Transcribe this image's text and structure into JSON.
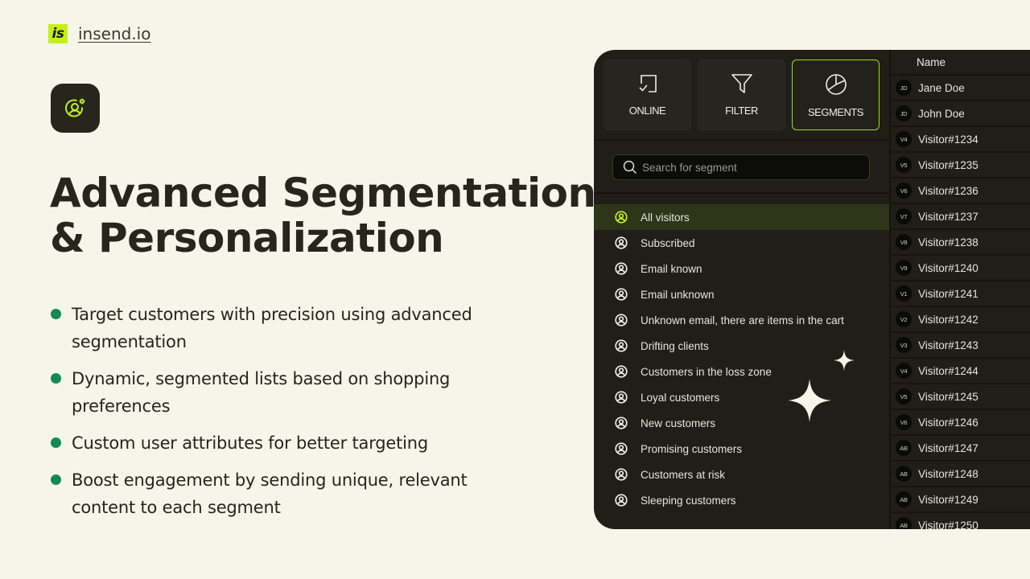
{
  "brand": {
    "logo_text": "is",
    "name": "insend.io",
    "accent": "#c4f01a"
  },
  "feature_icon": "user-settings-icon",
  "headline": {
    "line1": "Advanced Segmentation",
    "line2": "& Personalization"
  },
  "bullets": [
    "Target customers with precision using advanced segmentation",
    "Dynamic, segmented lists based on shopping preferences",
    "Custom user attributes for better targeting",
    "Boost engagement by sending unique, relevant content to each segment"
  ],
  "bullet_color": "#138a55",
  "panel": {
    "tabs": [
      {
        "label": "ONLINE",
        "icon": "chat-check-icon",
        "active": false
      },
      {
        "label": "FILTER",
        "icon": "funnel-icon",
        "active": false
      },
      {
        "label": "SEGMENTS",
        "icon": "pie-chart-icon",
        "active": true
      }
    ],
    "search": {
      "placeholder": "Search for segment",
      "value": ""
    },
    "segments": [
      {
        "label": "All visitors",
        "active": true
      },
      {
        "label": "Subscribed"
      },
      {
        "label": "Email known"
      },
      {
        "label": "Email unknown"
      },
      {
        "label": "Unknown email, there are items in the cart"
      },
      {
        "label": "Drifting clients"
      },
      {
        "label": "Customers in the loss zone"
      },
      {
        "label": "Loyal customers"
      },
      {
        "label": "New customers"
      },
      {
        "label": "Promising customers"
      },
      {
        "label": "Customers at risk"
      },
      {
        "label": "Sleeping customers"
      }
    ],
    "people_header": "Name",
    "people": [
      {
        "initials": "JD",
        "name": "Jane Doe"
      },
      {
        "initials": "JD",
        "name": "John Doe"
      },
      {
        "initials": "V4",
        "name": "Visitor#1234"
      },
      {
        "initials": "V5",
        "name": "Visitor#1235"
      },
      {
        "initials": "V6",
        "name": "Visitor#1236"
      },
      {
        "initials": "V7",
        "name": "Visitor#1237"
      },
      {
        "initials": "V8",
        "name": "Visitor#1238"
      },
      {
        "initials": "V9",
        "name": "Visitor#1240"
      },
      {
        "initials": "V1",
        "name": "Visitor#1241"
      },
      {
        "initials": "V2",
        "name": "Visitor#1242"
      },
      {
        "initials": "V3",
        "name": "Visitor#1243"
      },
      {
        "initials": "V4",
        "name": "Visitor#1244"
      },
      {
        "initials": "V5",
        "name": "Visitor#1245"
      },
      {
        "initials": "V6",
        "name": "Visitor#1246"
      },
      {
        "initials": "AB",
        "name": "Visitor#1247"
      },
      {
        "initials": "AB",
        "name": "Visitor#1248"
      },
      {
        "initials": "AB",
        "name": "Visitor#1249"
      },
      {
        "initials": "AB",
        "name": "Visitor#1250"
      }
    ]
  }
}
